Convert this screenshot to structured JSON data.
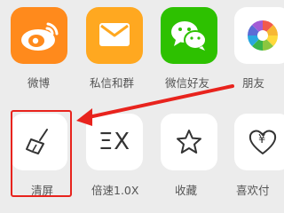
{
  "share_row": [
    {
      "label": "微博",
      "icon": "weibo-icon",
      "color": "#ff8a1c"
    },
    {
      "label": "私信和群",
      "icon": "mail-icon",
      "color": "#ffa820"
    },
    {
      "label": "微信好友",
      "icon": "wechat-icon",
      "color": "#2dc100"
    },
    {
      "label": "朋友",
      "icon": "moments-icon",
      "color": "#ffffff"
    }
  ],
  "action_row": [
    {
      "label": "清屏",
      "icon": "broom-icon"
    },
    {
      "label": "倍速1.0X",
      "icon": "speed-icon",
      "icon_text": "ΞX"
    },
    {
      "label": "收藏",
      "icon": "star-icon"
    },
    {
      "label": "喜欢付",
      "icon": "heart-yen-icon",
      "icon_text": "¥"
    }
  ],
  "annotation": {
    "arrow_color": "#e8231d",
    "highlight": "清屏"
  }
}
